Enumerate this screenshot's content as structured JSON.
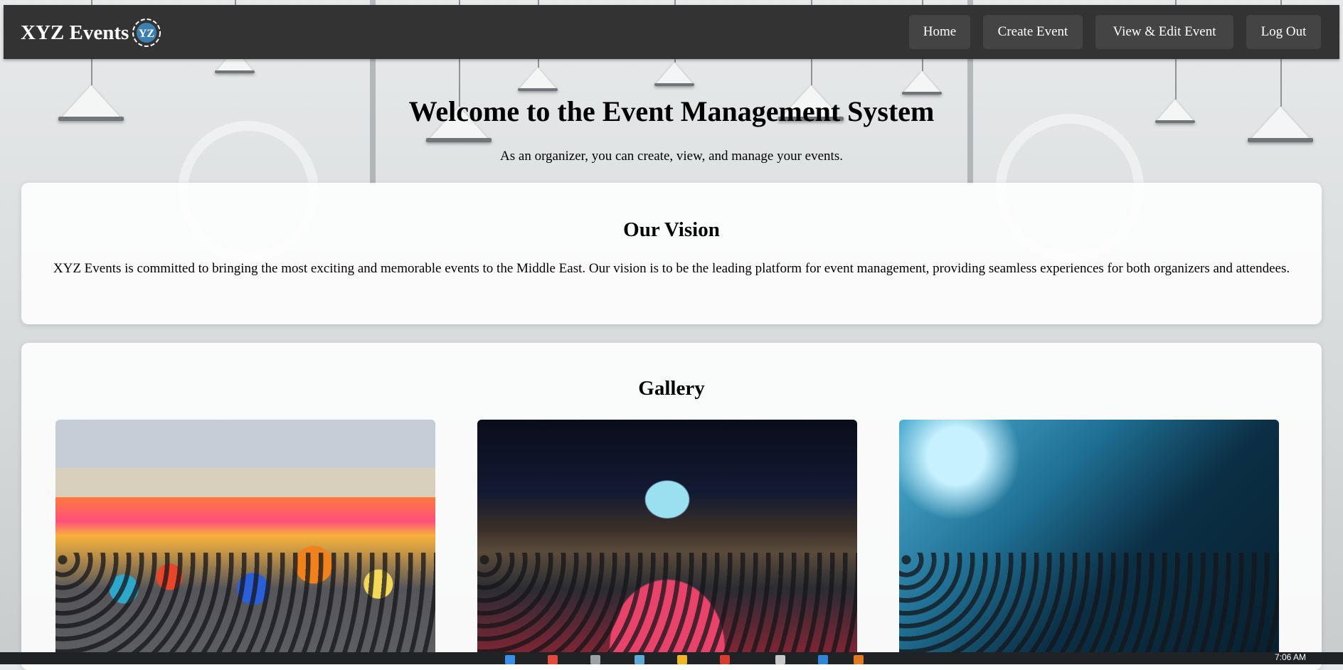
{
  "navbar": {
    "brand": "XYZ Events",
    "logo_text": "YZ",
    "links": [
      {
        "label": "Home"
      },
      {
        "label": "Create Event"
      },
      {
        "label": "View & Edit Event"
      },
      {
        "label": "Log Out"
      }
    ]
  },
  "hero": {
    "title": "Welcome to the Event Management System",
    "subtitle": "As an organizer, you can create, view, and manage your events."
  },
  "vision": {
    "title": "Our Vision",
    "text": "XYZ Events is committed to bringing the most exciting and memorable events to the Middle East. Our vision is to be the leading platform for event management, providing seamless experiences for both organizers and attendees."
  },
  "gallery": {
    "title": "Gallery",
    "images": [
      {
        "name": "parade-photo"
      },
      {
        "name": "conference-photo"
      },
      {
        "name": "concert-photo"
      }
    ]
  },
  "taskbar": {
    "clock": "7:06 AM"
  },
  "colors": {
    "navbar_bg": "#333333",
    "nav_button_bg": "#444444",
    "nav_text": "#ffffff",
    "card_bg": "#ffffff"
  }
}
